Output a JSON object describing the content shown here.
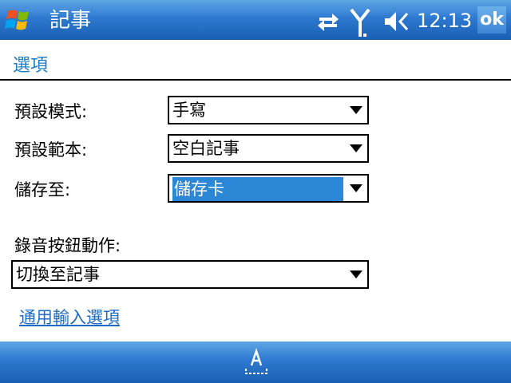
{
  "titlebar": {
    "title": "記事",
    "clock": "12:13",
    "ok_label": "ok",
    "icons": [
      "windows-start-icon",
      "connectivity-icon",
      "signal-icon",
      "volume-icon"
    ]
  },
  "page": {
    "header": "選項"
  },
  "form": {
    "default_mode_label": "預設模式:",
    "default_mode_value": "手寫",
    "default_template_label": "預設範本:",
    "default_template_value": "空白記事",
    "save_to_label": "儲存至:",
    "save_to_value": "儲存卡",
    "record_button_label": "錄音按鈕動作:",
    "record_button_value": "切換至記事"
  },
  "links": {
    "global_input_options": "通用輸入選項"
  },
  "bottombar": {
    "icons": [
      "input-panel-icon"
    ]
  },
  "colors": {
    "titlebar": "#2d79cf",
    "header_text": "#1e7bc4",
    "selection": "#2b86d6",
    "link": "#1e6bc4"
  }
}
